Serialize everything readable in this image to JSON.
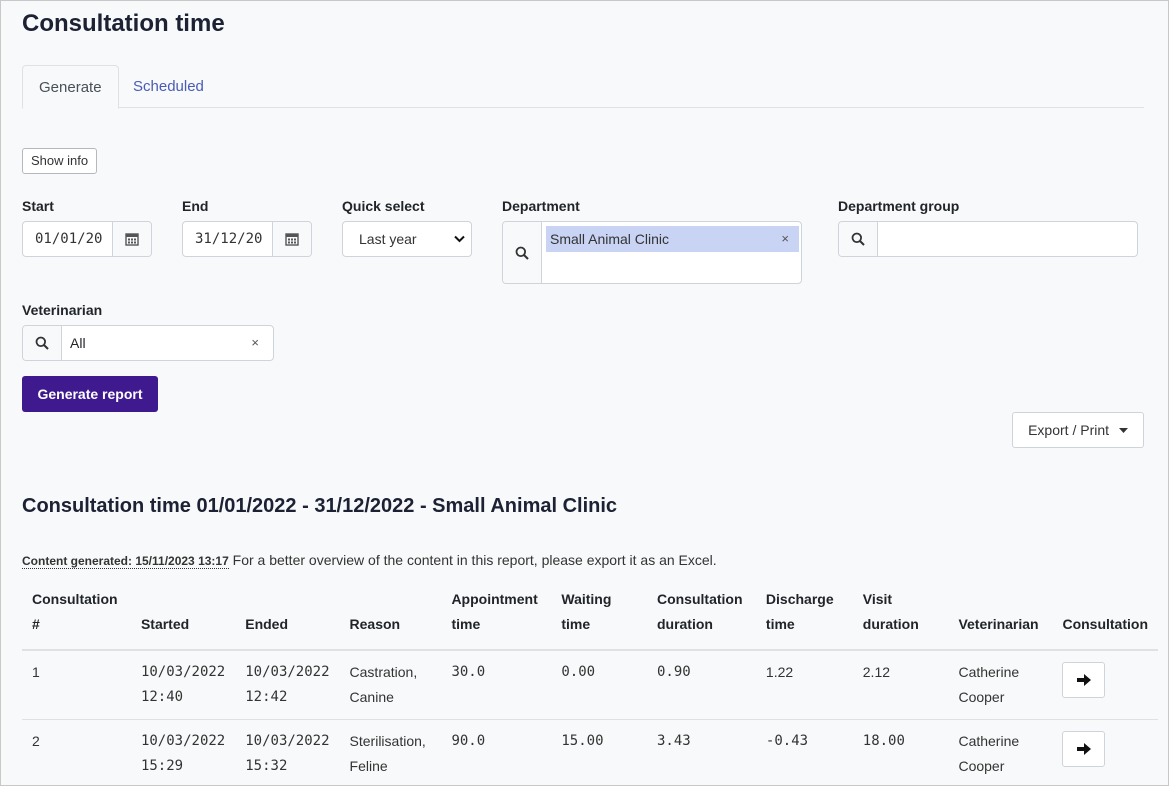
{
  "page": {
    "title": "Consultation time"
  },
  "tabs": [
    {
      "label": "Generate"
    },
    {
      "label": "Scheduled"
    }
  ],
  "show_info": "Show info",
  "form": {
    "start": {
      "label": "Start",
      "value": "01/01/20"
    },
    "end": {
      "label": "End",
      "value": "31/12/20"
    },
    "quick_select": {
      "label": "Quick select",
      "value": "Last year"
    },
    "department": {
      "label": "Department",
      "selected": "Small Animal Clinic",
      "remove": "×"
    },
    "department_group": {
      "label": "Department group",
      "value": ""
    },
    "veterinarian": {
      "label": "Veterinarian",
      "value": "All",
      "clear": "×"
    }
  },
  "buttons": {
    "generate": "Generate report",
    "export": "Export / Print"
  },
  "report": {
    "title": "Consultation time 01/01/2022 - 31/12/2022 - Small Animal Clinic",
    "generated": "Content generated: 15/11/2023 13:17",
    "note": "For a better overview of the content in this report, please export it as an Excel."
  },
  "table": {
    "headers": [
      [
        "Consultation",
        "#"
      ],
      [
        "",
        "Started"
      ],
      [
        "",
        "Ended"
      ],
      [
        "",
        "Reason"
      ],
      [
        "Appointment",
        "time"
      ],
      [
        "Waiting",
        "time"
      ],
      [
        "Consultation",
        "duration"
      ],
      [
        "Discharge",
        "time"
      ],
      [
        "Visit",
        "duration"
      ],
      [
        "",
        "Veterinarian"
      ],
      [
        "",
        "Consultation"
      ]
    ],
    "rows": [
      {
        "num": "1",
        "started": [
          "10/03/2022",
          "12:40"
        ],
        "ended": [
          "10/03/2022",
          "12:42"
        ],
        "reason": [
          "Castration,",
          "Canine"
        ],
        "appointment": "30.0",
        "waiting": "0.00",
        "duration": "0.90",
        "discharge": "1.22",
        "visit": "2.12",
        "vet": [
          "Catherine",
          "Cooper"
        ]
      },
      {
        "num": "2",
        "started": [
          "10/03/2022",
          "15:29"
        ],
        "ended": [
          "10/03/2022",
          "15:32"
        ],
        "reason": [
          "Sterilisation,",
          "Feline"
        ],
        "appointment": "90.0",
        "waiting": "15.00",
        "duration": "3.43",
        "discharge": "-0.43",
        "visit": "18.00",
        "vet": [
          "Catherine",
          "Cooper"
        ]
      }
    ]
  }
}
